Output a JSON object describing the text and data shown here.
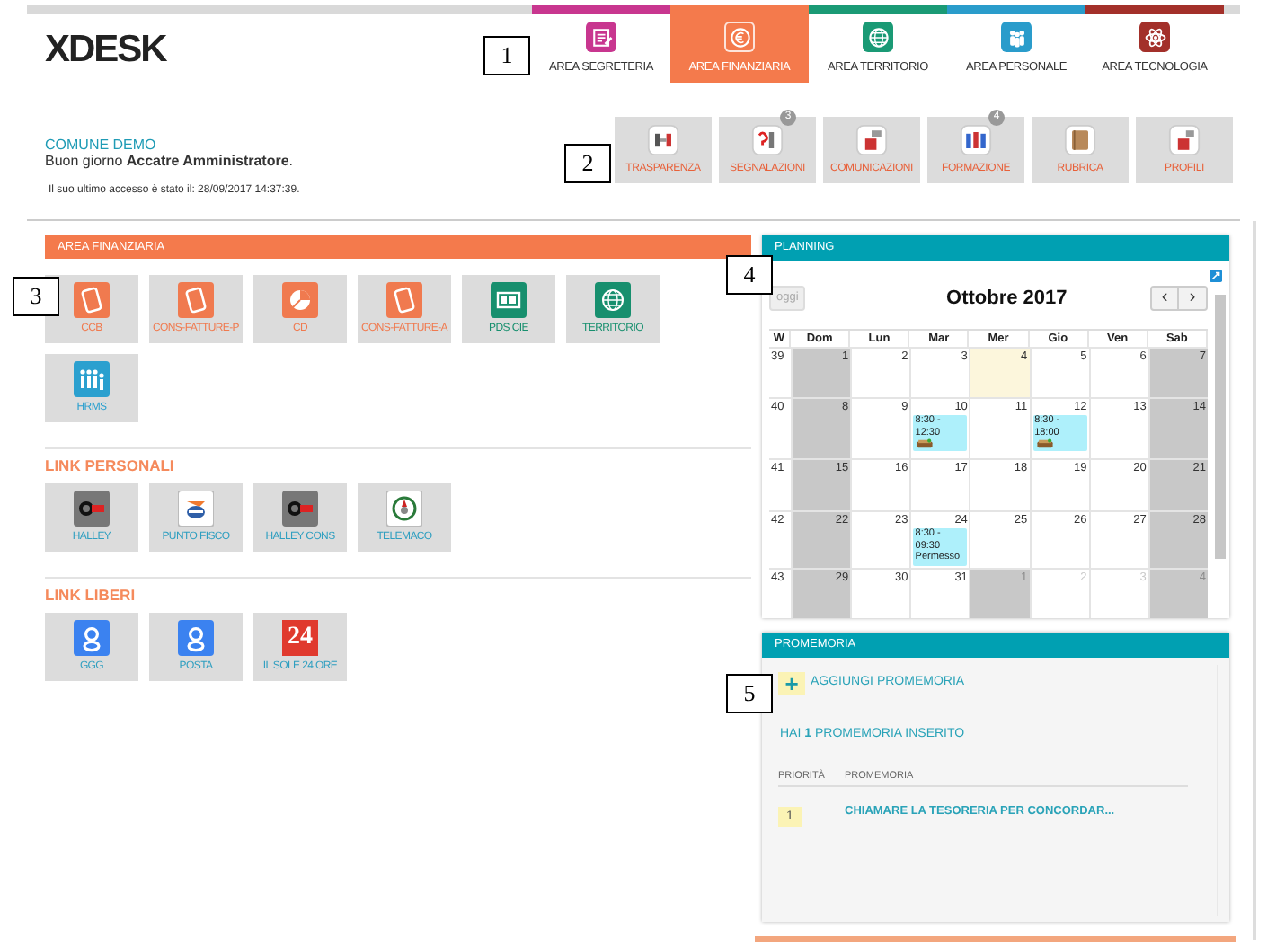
{
  "logo": "XDESK",
  "area_tabs": [
    {
      "label": "AREA SEGRETERIA",
      "color": "#c8368f",
      "selected": false
    },
    {
      "label": "AREA FINANZIARIA",
      "color": "#f47a4c",
      "selected": true
    },
    {
      "label": "AREA TERRITORIO",
      "color": "#1a9a75",
      "selected": false
    },
    {
      "label": "AREA PERSONALE",
      "color": "#2a9ccb",
      "selected": false
    },
    {
      "label": "AREA TECNOLOGIA",
      "color": "#a3302a",
      "selected": false
    }
  ],
  "user": {
    "entity": "COMUNE DEMO",
    "greeting": "Buon giorno **Accatre Amministratore**.",
    "last_access": "Il suo ultimo accesso è stato il: 28/09/2017 14:37:39."
  },
  "shortcuts": [
    {
      "label": "TRASPARENZA"
    },
    {
      "label": "SEGNALAZIONI",
      "badge": "3"
    },
    {
      "label": "COMUNICAZIONI"
    },
    {
      "label": "FORMAZIONE",
      "badge": "4"
    },
    {
      "label": "RUBRICA"
    },
    {
      "label": "PROFILI"
    }
  ],
  "area_panel": {
    "title": "AREA FINANZIARIA",
    "tiles": [
      {
        "label": "CCB",
        "color": "#f07a4f"
      },
      {
        "label": "CONS-FATTURE-P",
        "color": "#f07a4f"
      },
      {
        "label": "CD",
        "color": "#f07a4f"
      },
      {
        "label": "CONS-FATTURE-A",
        "color": "#f07a4f"
      },
      {
        "label": "PDS CIE",
        "color": "#178f6e"
      },
      {
        "label": "TERRITORIO",
        "color": "#178f6e"
      },
      {
        "label": "HRMS",
        "color": "#2ba0cf"
      }
    ]
  },
  "link_sections": [
    {
      "title": "LINK PERSONALI",
      "tiles": [
        {
          "label": "HALLEY"
        },
        {
          "label": "PUNTO FISCO"
        },
        {
          "label": "HALLEY CONS"
        },
        {
          "label": "TELEMACO"
        }
      ]
    },
    {
      "title": "LINK LIBERI",
      "tiles": [
        {
          "label": "GGG"
        },
        {
          "label": "POSTA"
        },
        {
          "label": "IL SOLE 24 ORE",
          "icon_text": "24"
        }
      ]
    }
  ],
  "planning": {
    "title": "PLANNING",
    "today_button": "oggi",
    "month": "Ottobre 2017",
    "prev": "‹",
    "next": "›",
    "columns": [
      "W",
      "Dom",
      "Lun",
      "Mar",
      "Mer",
      "Gio",
      "Ven",
      "Sab"
    ],
    "weeks": [
      {
        "week": "39",
        "days": [
          {
            "n": "1",
            "kind": "shaded"
          },
          {
            "n": "2",
            "kind": "plain"
          },
          {
            "n": "3",
            "kind": "plain"
          },
          {
            "n": "4",
            "kind": "today"
          },
          {
            "n": "5",
            "kind": "plain"
          },
          {
            "n": "6",
            "kind": "plain"
          },
          {
            "n": "7",
            "kind": "shaded"
          }
        ]
      },
      {
        "week": "40",
        "days": [
          {
            "n": "8",
            "kind": "shaded"
          },
          {
            "n": "9",
            "kind": "plain"
          },
          {
            "n": "10",
            "kind": "plain",
            "events": [
              {
                "kind": "work",
                "time": "8:30 - 12:30"
              }
            ]
          },
          {
            "n": "11",
            "kind": "plain"
          },
          {
            "n": "12",
            "kind": "plain",
            "events": [
              {
                "kind": "work",
                "time": "8:30 - 18:00"
              }
            ]
          },
          {
            "n": "13",
            "kind": "plain"
          },
          {
            "n": "14",
            "kind": "shaded"
          }
        ]
      },
      {
        "week": "41",
        "days": [
          {
            "n": "15",
            "kind": "shaded"
          },
          {
            "n": "16",
            "kind": "plain"
          },
          {
            "n": "17",
            "kind": "plain"
          },
          {
            "n": "18",
            "kind": "plain"
          },
          {
            "n": "19",
            "kind": "plain"
          },
          {
            "n": "20",
            "kind": "plain"
          },
          {
            "n": "21",
            "kind": "shaded"
          }
        ]
      },
      {
        "week": "42",
        "days": [
          {
            "n": "22",
            "kind": "shaded"
          },
          {
            "n": "23",
            "kind": "plain"
          },
          {
            "n": "24",
            "kind": "plain",
            "events": [
              {
                "kind": "leave",
                "time": "8:30 - 09:30",
                "label": "Permesso"
              }
            ]
          },
          {
            "n": "25",
            "kind": "plain"
          },
          {
            "n": "26",
            "kind": "plain"
          },
          {
            "n": "27",
            "kind": "plain"
          },
          {
            "n": "28",
            "kind": "shaded"
          }
        ]
      },
      {
        "week": "43",
        "days": [
          {
            "n": "29",
            "kind": "shaded"
          },
          {
            "n": "30",
            "kind": "plain"
          },
          {
            "n": "31",
            "kind": "plain"
          },
          {
            "n": "1",
            "kind": "outside-shaded"
          },
          {
            "n": "2",
            "kind": "outside"
          },
          {
            "n": "3",
            "kind": "outside"
          },
          {
            "n": "4",
            "kind": "outside-shaded"
          }
        ]
      }
    ]
  },
  "reminders": {
    "title": "PROMEMORIA",
    "add_icon": "+",
    "add_label": "AGGIUNGI PROMEMORIA",
    "summary": "HAI **1** PROMEMORIA INSERITO",
    "columns": [
      "PRIORITÀ",
      "PROMEMORIA"
    ],
    "rows": [
      {
        "priority": "1",
        "text": "CHIAMARE LA TESORERIA PER CONCORDAR..."
      }
    ]
  },
  "callouts": [
    {
      "label": "1"
    },
    {
      "label": "2"
    },
    {
      "label": "3"
    },
    {
      "label": "4"
    },
    {
      "label": "5"
    }
  ]
}
